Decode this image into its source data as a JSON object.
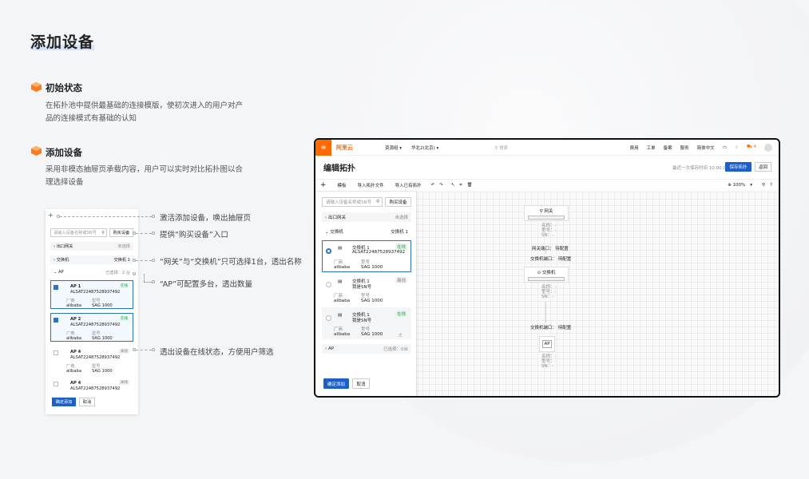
{
  "page_title": "添加设备",
  "sections": [
    {
      "title": "初始状态",
      "desc": "在拓扑池中提供最基础的连接模版，使初次进入的用户对产品的连接模式有基础的认知"
    },
    {
      "title": "添加设备",
      "desc": "采用非模态抽屉页承载内容，用户可以实时对比拓扑图以合理选择设备"
    }
  ],
  "mini": {
    "plus": "+",
    "search_placeholder": "请输入设备名称或SN号",
    "buy_button": "购买设备",
    "groups": [
      {
        "name": "出口网关",
        "status": "未选择"
      },
      {
        "name": "交换机",
        "status": "交换机 1"
      },
      {
        "name": "AP",
        "status": "已选择：2 台"
      }
    ],
    "cards": [
      {
        "name": "AP 1",
        "sn": "ALSAT22487528937492",
        "tag": "在线",
        "vendor_label": "厂商",
        "vendor": "alibaba",
        "model_label": "型号",
        "model": "SAG 1000"
      },
      {
        "name": "AP 2",
        "sn": "ALSAT22487528937492",
        "tag": "在线",
        "vendor_label": "厂商",
        "vendor": "alibaba",
        "model_label": "型号",
        "model": "SAG 1000"
      },
      {
        "name": "AP 4",
        "sn": "ALSAT22487528937492",
        "tag": "离线",
        "vendor_label": "厂商",
        "vendor": "alibaba",
        "model_label": "型号",
        "model": "SAG 1000"
      },
      {
        "name": "AP 4",
        "sn": "ALSAT22487528937492",
        "tag": "离线",
        "vendor_label": "厂商",
        "vendor": "alibaba",
        "model_label": "型号",
        "model": "SAG 1000"
      }
    ],
    "confirm": "确定添加",
    "cancel": "取消"
  },
  "callouts": [
    "激活添加设备，唤出抽屉页",
    "提供“购买设备”入口",
    "“网关”与“交换机”只可选择1台，透出名称",
    "“AP”可配置多台，透出数量",
    "透出设备在线状态，方便用户筛选"
  ],
  "win": {
    "logo": "阿里云",
    "nav": [
      "资源组 ▾",
      "华北2(北京) ▾"
    ],
    "search": "搜索",
    "top_links": [
      "费用",
      "工单",
      "备案",
      "服务",
      "简体中文"
    ],
    "cart_count": "4",
    "page_title": "编辑拓扑",
    "save_time": "最近一次保存时间 10:00:00",
    "save_btn": "保存拓扑",
    "back_btn": "返回",
    "tools": [
      "模板",
      "导入拓扑文件",
      "导入已有拓扑"
    ],
    "zoom": "100%",
    "drawer": {
      "search_placeholder": "请输入设备名称或SN号",
      "buy_button": "购买设备",
      "groups": [
        {
          "name": "出口网关",
          "status": "未选择"
        },
        {
          "name": "交换机",
          "status": "交换机 1"
        }
      ],
      "cards": [
        {
          "name": "交换机 1",
          "sn": "ALSAT22487528937492",
          "tag": "在线",
          "vendor_label": "厂商",
          "vendor": "alibaba",
          "model_label": "型号",
          "model": "SAG 1000"
        },
        {
          "name": "交换机 1",
          "sn": "我是SN号",
          "tag": "离线",
          "vendor_label": "厂商",
          "vendor": "alibaba",
          "model_label": "型号",
          "model": "SAG 1000"
        },
        {
          "name": "交换机 1",
          "sn": "我是SN号",
          "tag": "在线",
          "vendor_label": "厂商",
          "vendor": "alibaba",
          "model_label": "型号",
          "model": "SAG 1000"
        }
      ],
      "ap_group": {
        "name": "AP",
        "status": "已选择：0台"
      },
      "confirm": "确定添加",
      "cancel": "取消"
    },
    "canvas": {
      "gateway": "网关",
      "switch": "交换机",
      "meta": [
        "名称：-",
        "型号：-",
        "SN：-"
      ],
      "port1": "网关端口：  待配置",
      "port2": "交换机端口：  待配置",
      "port3": "交换机端口：  待配置",
      "ap_label": "AP"
    }
  }
}
